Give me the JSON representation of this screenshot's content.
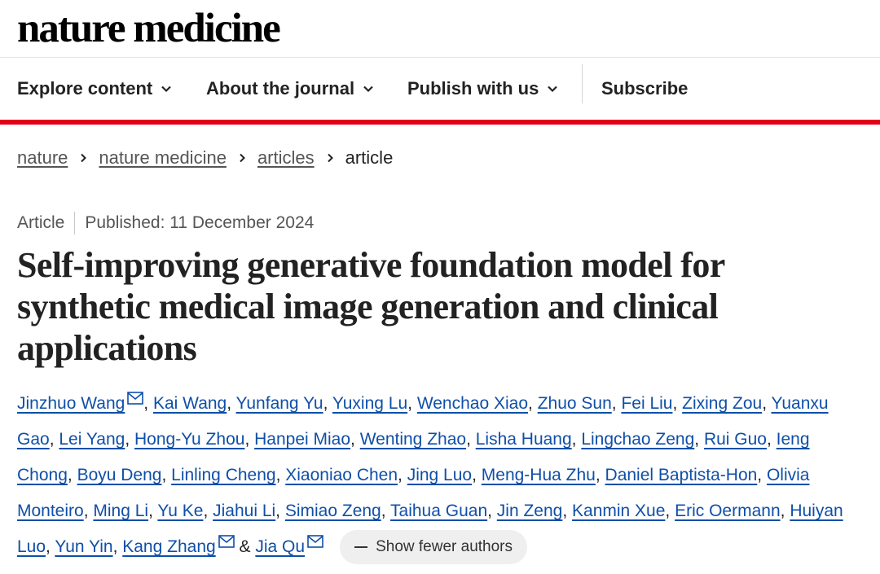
{
  "brand": {
    "logo_text": "nature medicine"
  },
  "nav": {
    "items": [
      {
        "label": "Explore content"
      },
      {
        "label": "About the journal"
      },
      {
        "label": "Publish with us"
      }
    ],
    "subscribe_label": "Subscribe"
  },
  "breadcrumb": {
    "items": [
      {
        "label": "nature"
      },
      {
        "label": "nature medicine"
      },
      {
        "label": "articles"
      }
    ],
    "current": "article"
  },
  "article": {
    "type": "Article",
    "published": "Published: 11 December 2024",
    "title": "Self-improving generative foundation model for synthetic medical image generation and clinical applications"
  },
  "authors": [
    "Jinzhuo Wang",
    "Kai Wang",
    "Yunfang Yu",
    "Yuxing Lu",
    "Wenchao Xiao",
    "Zhuo Sun",
    "Fei Liu",
    "Zixing Zou",
    "Yuanxu Gao",
    "Lei Yang",
    "Hong-Yu Zhou",
    "Hanpei Miao",
    "Wenting Zhao",
    "Lisha Huang",
    "Lingchao Zeng",
    "Rui Guo",
    "Ieng Chong",
    "Boyu Deng",
    "Linling Cheng",
    "Xiaoniao Chen",
    "Jing Luo",
    "Meng-Hua Zhu",
    "Daniel Baptista-Hon",
    "Olivia Monteiro",
    "Ming Li",
    "Yu Ke",
    "Jiahui Li",
    "Simiao Zeng",
    "Taihua Guan",
    "Jin Zeng",
    "Kanmin Xue",
    "Eric Oermann",
    "Huiyan Luo",
    "Yun Yin",
    "Kang Zhang",
    "Jia Qu"
  ],
  "corresponding_authors": [
    "Jinzhuo Wang",
    "Kang Zhang",
    "Jia Qu"
  ],
  "author_separator": ", ",
  "author_last_joiner": "&",
  "show_fewer_label": "Show fewer authors",
  "colors": {
    "accent_red": "#e3001b",
    "link_blue": "#0f4fa8"
  }
}
